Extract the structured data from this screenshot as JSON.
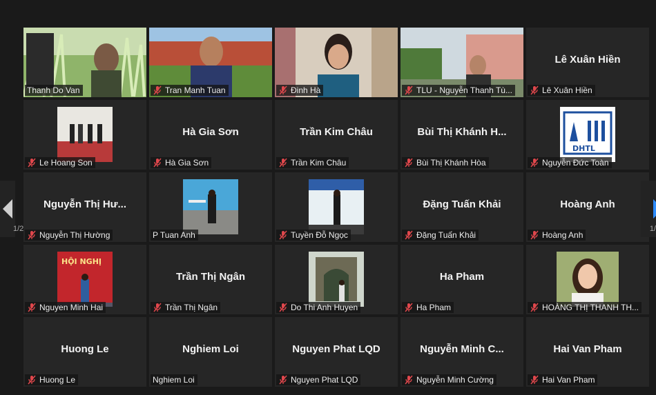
{
  "participants": [
    {
      "name": "Thanh Do Van",
      "display": "",
      "muted": false,
      "kind": "video-farm",
      "active": true
    },
    {
      "name": "Tran Manh Tuan",
      "display": "",
      "muted": true,
      "kind": "video-campus"
    },
    {
      "name": "Đinh Hà",
      "display": "",
      "muted": true,
      "kind": "video-woman"
    },
    {
      "name": "TLU - Nguyễn Thanh Tù...",
      "display": "",
      "muted": true,
      "kind": "video-building"
    },
    {
      "name": "Lê Xuân Hiền",
      "display": "Lê Xuân Hiền",
      "muted": true,
      "kind": "name"
    },
    {
      "name": "Le Hoang Son",
      "display": "",
      "muted": true,
      "kind": "thumb-event"
    },
    {
      "name": "Hà Gia Sơn",
      "display": "Hà Gia Sơn",
      "muted": true,
      "kind": "name"
    },
    {
      "name": "Trần Kim Châu",
      "display": "Trần Kim Châu",
      "muted": true,
      "kind": "name"
    },
    {
      "name": "Bùi Thị Khánh Hòa",
      "display": "Bùi Thị Khánh H...",
      "muted": true,
      "kind": "name"
    },
    {
      "name": "Nguyễn Đức Toàn",
      "display": "",
      "muted": true,
      "kind": "thumb-logo",
      "logo_text": "DHTL"
    },
    {
      "name": "Nguyễn Thị Hường",
      "display": "Nguyễn Thị Hư...",
      "muted": true,
      "kind": "name"
    },
    {
      "name": "P Tuan Anh",
      "display": "",
      "muted": false,
      "kind": "thumb-beach"
    },
    {
      "name": "Tuyền Đỗ Ngọc",
      "display": "",
      "muted": true,
      "kind": "thumb-stage"
    },
    {
      "name": "Đặng Tuấn Khải",
      "display": "Đặng Tuấn Khải",
      "muted": true,
      "kind": "name"
    },
    {
      "name": "Hoàng Anh",
      "display": "Hoàng Anh",
      "muted": true,
      "kind": "name"
    },
    {
      "name": "Nguyen Minh Hai",
      "display": "",
      "muted": true,
      "kind": "thumb-conference",
      "banner_text": "HỘI NGHỊ"
    },
    {
      "name": "Trần Thị Ngân",
      "display": "Trần Thị Ngân",
      "muted": true,
      "kind": "name"
    },
    {
      "name": "Do Thi Anh Huyen",
      "display": "",
      "muted": true,
      "kind": "thumb-ruins"
    },
    {
      "name": "Ha Pham",
      "display": "Ha Pham",
      "muted": true,
      "kind": "name"
    },
    {
      "name": "HOÀNG THỊ THANH TH...",
      "display": "",
      "muted": true,
      "kind": "thumb-girl"
    },
    {
      "name": "Huong Le",
      "display": "Huong Le",
      "muted": true,
      "kind": "name"
    },
    {
      "name": "Nghiem Loi",
      "display": "Nghiem Loi",
      "muted": false,
      "kind": "name"
    },
    {
      "name": "Nguyen Phat LQD",
      "display": "Nguyen Phat LQD",
      "muted": true,
      "kind": "name"
    },
    {
      "name": "Nguyễn Minh Cường",
      "display": "Nguyễn Minh C...",
      "muted": true,
      "kind": "name"
    },
    {
      "name": "Hai Van Pham",
      "display": "Hai Van Pham",
      "muted": true,
      "kind": "name"
    }
  ],
  "pagination": {
    "left_label": "1/2",
    "right_label": "1/"
  },
  "colors": {
    "active_border": "#f4e27a",
    "mic_muted": "#e0474c",
    "arrow": "#2d8cff"
  }
}
